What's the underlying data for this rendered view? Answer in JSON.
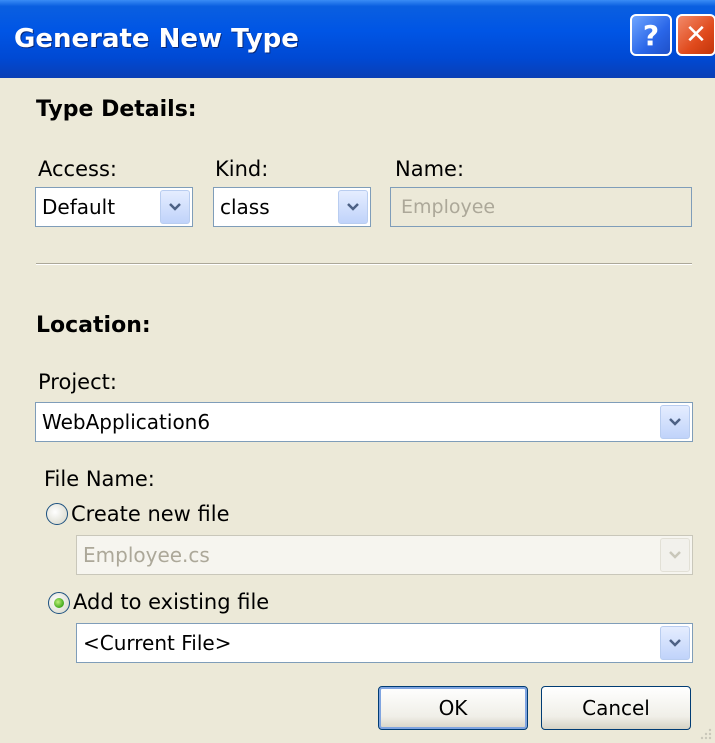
{
  "window": {
    "title": "Generate New Type"
  },
  "titlebar_buttons": {
    "help": "?",
    "close": "✕"
  },
  "type_details": {
    "heading": "Type Details:",
    "access_label": "Access:",
    "access_value": "Default",
    "kind_label": "Kind:",
    "kind_value": "class",
    "name_label": "Name:",
    "name_value": "Employee"
  },
  "location": {
    "heading": "Location:",
    "project_label": "Project:",
    "project_value": "WebApplication6",
    "file_name_label": "File Name:",
    "create_new_label": "Create new file",
    "create_new_value": "Employee.cs",
    "create_new_selected": false,
    "add_existing_label": "Add to existing file",
    "add_existing_value": "<Current File>",
    "add_existing_selected": true
  },
  "buttons": {
    "ok": "OK",
    "cancel": "Cancel"
  },
  "colors": {
    "titlebar": "#0055e5",
    "dialog_background": "#ece9d8",
    "combo_border": "#7f9db9",
    "disabled_text": "#aca899"
  },
  "icons": [
    "help-icon",
    "close-icon",
    "chevron-down-icon",
    "radio-icon"
  ]
}
